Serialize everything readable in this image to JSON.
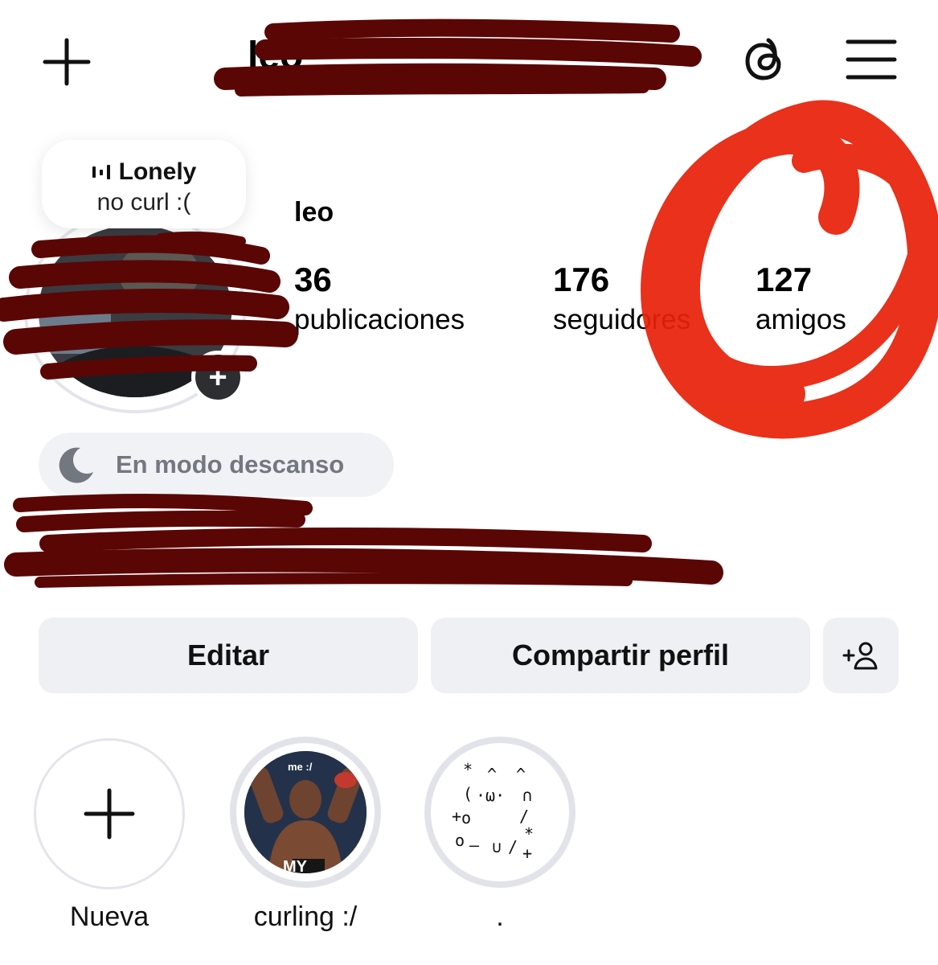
{
  "header": {
    "username": "leo",
    "add_icon": "plus-icon",
    "threads_icon": "threads-icon",
    "menu_icon": "hamburger-menu-icon"
  },
  "note": {
    "music_icon": "audio-bars-icon",
    "song": "Lonely",
    "text": "no curl :("
  },
  "profile": {
    "name": "leo",
    "stats": [
      {
        "value": "36",
        "label": "publicaciones"
      },
      {
        "value": "176",
        "label": "seguidores"
      },
      {
        "value": "127",
        "label": "amigos"
      }
    ]
  },
  "status": {
    "icon": "moon-icon",
    "text": "En modo descanso"
  },
  "actions": {
    "edit_label": "Editar",
    "share_label": "Compartir perfil",
    "add_user_icon": "add-user-icon"
  },
  "highlights": [
    {
      "label": "Nueva",
      "caption": ""
    },
    {
      "label": "curling :/",
      "caption": "me :/"
    },
    {
      "label": ".",
      "caption": ""
    }
  ],
  "colors": {
    "redaction": "#5a0605",
    "annotation_circle": "#e8220a",
    "button_bg": "#eff0f3",
    "status_text": "#737780"
  }
}
